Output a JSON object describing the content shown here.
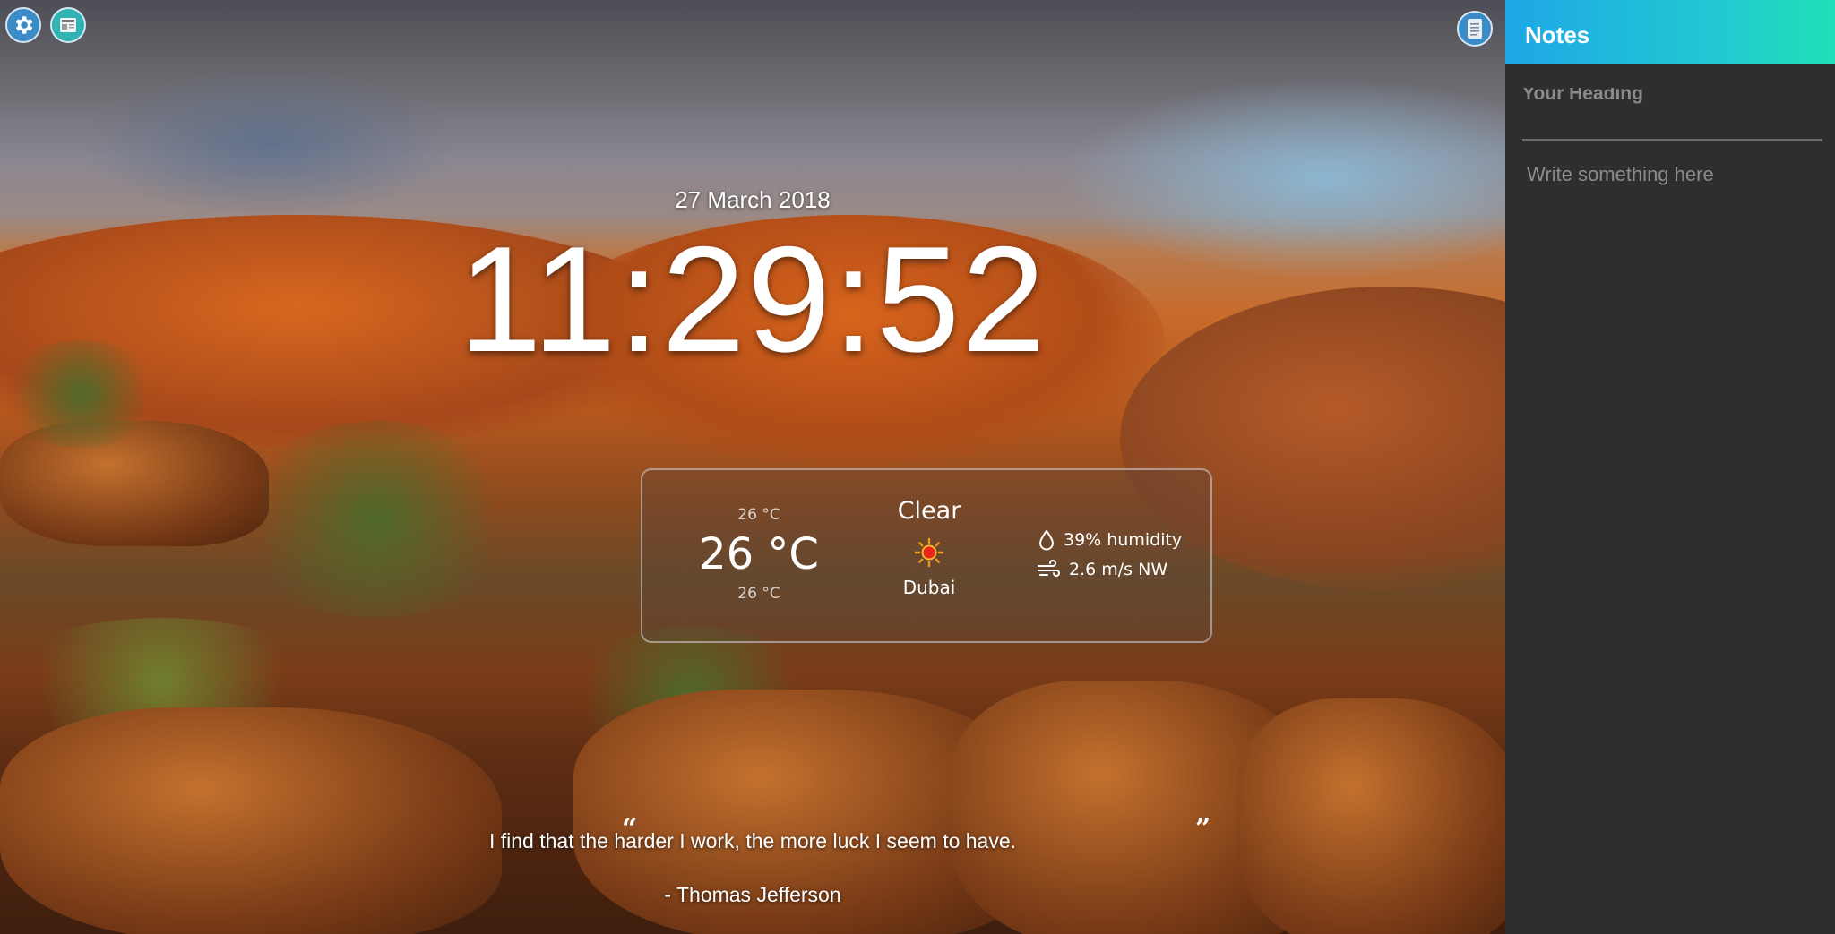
{
  "toolbar": {
    "settings_icon": "gear-icon",
    "news_icon": "newspaper-icon",
    "notes_icon": "notepad-icon"
  },
  "clock": {
    "date": "27 March 2018",
    "time": "11:29:52"
  },
  "weather": {
    "temp_max": "26 °C",
    "temp_current": "26 °C",
    "temp_min": "26 °C",
    "condition": "Clear",
    "condition_icon": "sun-icon",
    "city": "Dubai",
    "humidity": "39% humidity",
    "wind": "2.6 m/s NW"
  },
  "quote": {
    "text": "I find that the harder I work, the more luck I seem to have.",
    "author": "- Thomas Jefferson"
  },
  "notes": {
    "title": "Notes",
    "heading_placeholder": "Your Heading",
    "body_placeholder": "Write something here"
  },
  "colors": {
    "notes_gradient_start": "#1ea7e6",
    "notes_gradient_end": "#1fe0b8",
    "notes_bg": "#2e2e2e",
    "icon_blue": "#3a8bc6",
    "icon_teal": "#2fb3b3"
  }
}
